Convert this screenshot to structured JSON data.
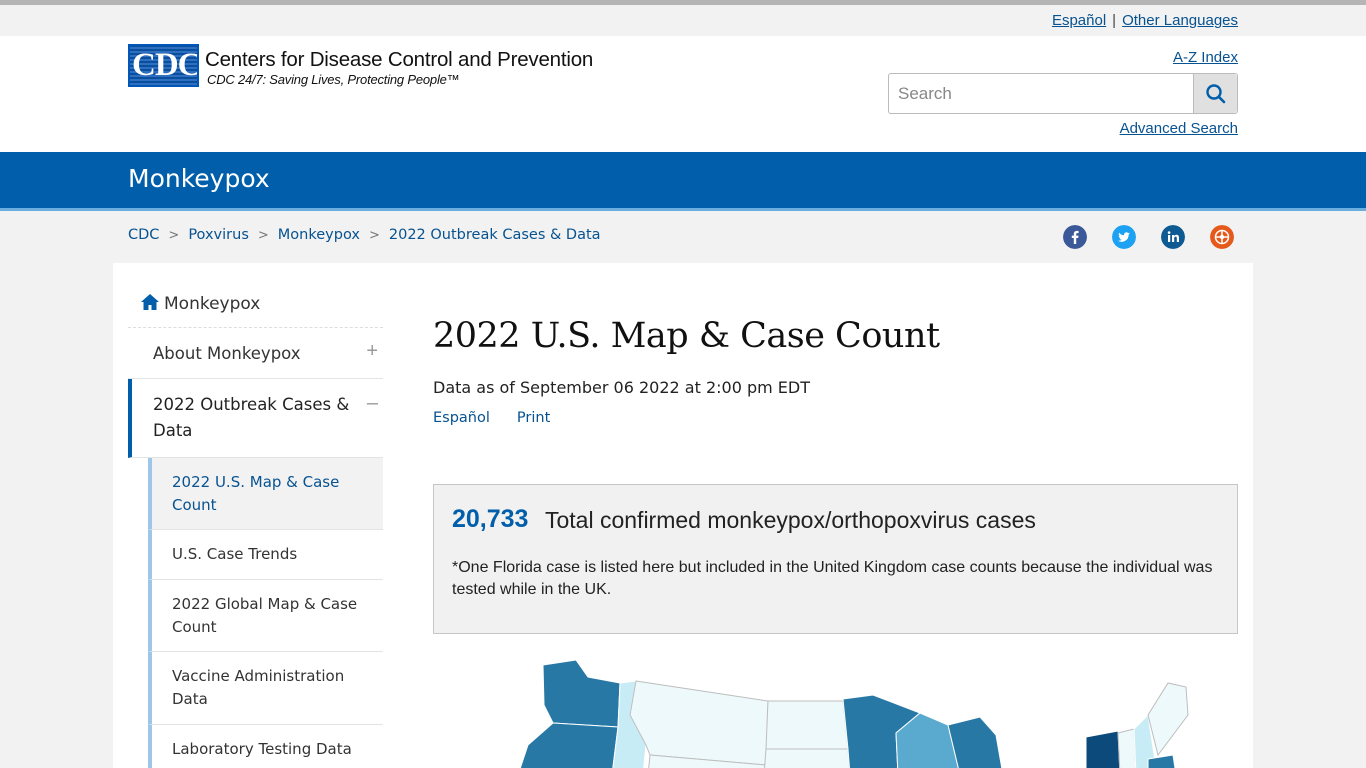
{
  "language_bar": {
    "espanol": "Español",
    "separator": "|",
    "other": "Other Languages"
  },
  "header": {
    "logo_text": "CDC",
    "org_name": "Centers for Disease Control and Prevention",
    "tagline": "CDC 24/7: Saving Lives, Protecting People™",
    "az_index": "A-Z Index",
    "search_placeholder": "Search",
    "search_value": "",
    "advanced_search": "Advanced Search"
  },
  "topic_bar": {
    "title": "Monkeypox"
  },
  "breadcrumb": [
    "CDC",
    "Poxvirus",
    "Monkeypox",
    "2022 Outbreak Cases & Data"
  ],
  "breadcrumb_separator": ">",
  "social_icons": [
    "facebook-icon",
    "twitter-icon",
    "linkedin-icon",
    "syndicate-icon"
  ],
  "colors": {
    "brand_blue": "#005eaa",
    "link_blue": "#075290",
    "facebook": "#3b5998",
    "twitter": "#1da1f2",
    "linkedin": "#0e5a92",
    "syndicate": "#e55a1b"
  },
  "sidebar": {
    "home": "Monkeypox",
    "items": [
      {
        "label": "About Monkeypox",
        "sign": "+"
      },
      {
        "label": "2022 Outbreak Cases & Data",
        "sign": "–"
      }
    ],
    "subitems": [
      {
        "label": "2022 U.S. Map & Case Count",
        "active": true
      },
      {
        "label": "U.S. Case Trends",
        "active": false
      },
      {
        "label": "2022 Global Map & Case Count",
        "active": false
      },
      {
        "label": "Vaccine Administration Data",
        "active": false
      },
      {
        "label": "Laboratory Testing Data",
        "active": false
      }
    ]
  },
  "main": {
    "title": "2022 U.S. Map & Case Count",
    "data_as_of": "Data as of September 06 2022 at 2:00 pm EDT",
    "links": [
      "Español",
      "Print"
    ],
    "callout": {
      "count": "20,733",
      "label": "Total confirmed monkeypox/orthopoxvirus cases",
      "note": "*One Florida case is listed here but included in the United Kingdom case counts because the individual was tested while in the UK."
    }
  }
}
